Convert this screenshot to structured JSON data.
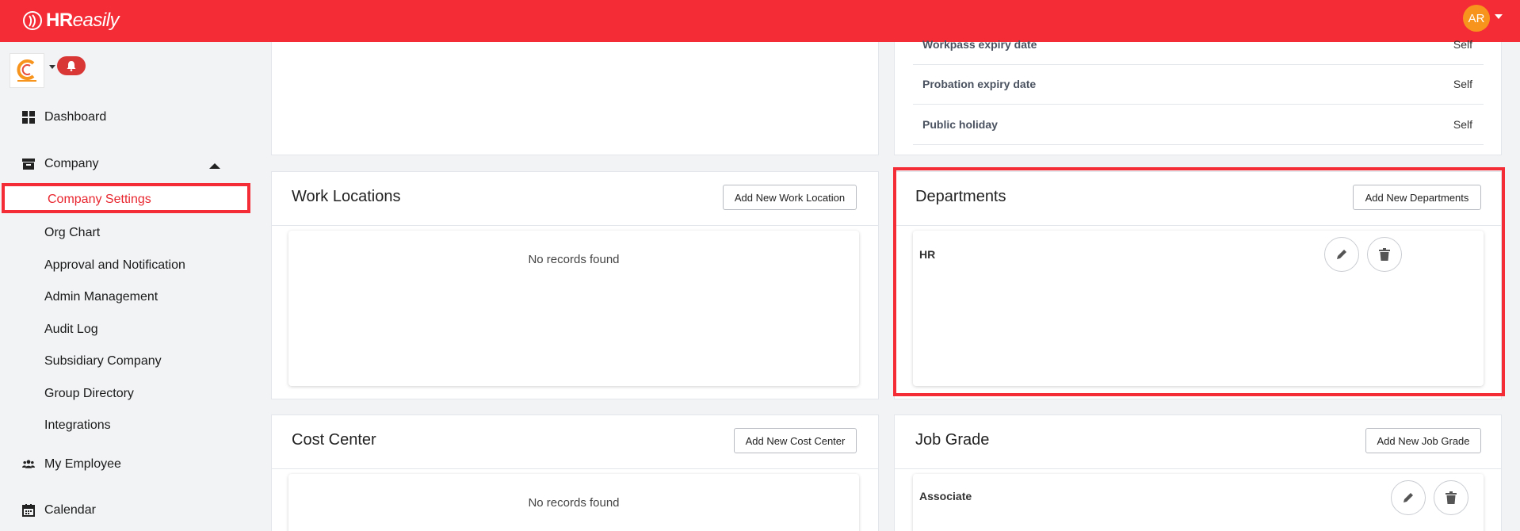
{
  "app": {
    "logo_text_bold": "HR",
    "logo_text_italic": "easily",
    "user_initials": "AR",
    "brand_color": "#f42c35"
  },
  "sidebar": {
    "items": [
      {
        "label": "Dashboard",
        "icon": "dashboard-icon"
      },
      {
        "label": "Company",
        "icon": "archive-icon"
      },
      {
        "label": "My Employee",
        "icon": "users-icon"
      },
      {
        "label": "Calendar",
        "icon": "calendar-icon"
      }
    ],
    "company_subitems": [
      "Company Settings",
      "Org Chart",
      "Approval and Notification",
      "Admin Management",
      "Audit Log",
      "Subsidiary Company",
      "Group Directory",
      "Integrations"
    ]
  },
  "notifications": {
    "rows": [
      {
        "label": "Workpass expiry date",
        "value": "Self"
      },
      {
        "label": "Probation expiry date",
        "value": "Self"
      },
      {
        "label": "Public holiday",
        "value": "Self"
      }
    ]
  },
  "work_locations": {
    "title": "Work Locations",
    "button": "Add New Work Location",
    "empty": "No records found"
  },
  "departments": {
    "title": "Departments",
    "button": "Add New Departments",
    "rows": [
      "HR"
    ]
  },
  "cost_center": {
    "title": "Cost Center",
    "button": "Add New Cost Center",
    "empty": "No records found"
  },
  "job_grade": {
    "title": "Job Grade",
    "button": "Add New Job Grade",
    "rows": [
      "Associate"
    ]
  }
}
